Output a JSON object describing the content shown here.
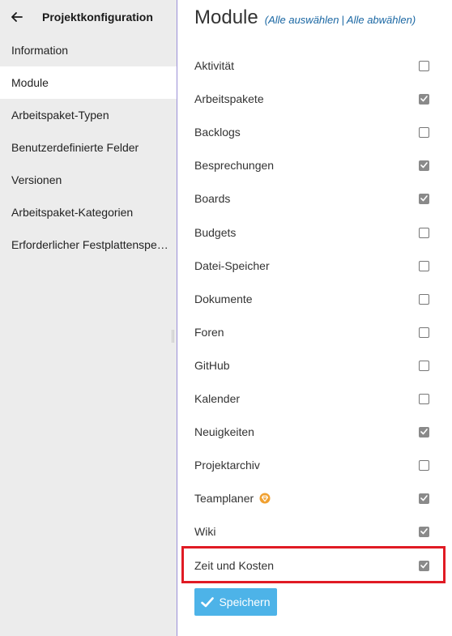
{
  "sidebar": {
    "title": "Projektkonfiguration",
    "back_icon": "arrow-left-icon",
    "items": [
      {
        "label": "Information",
        "active": false
      },
      {
        "label": "Module",
        "active": true
      },
      {
        "label": "Arbeitspaket-Typen",
        "active": false
      },
      {
        "label": "Benutzerdefinierte Felder",
        "active": false
      },
      {
        "label": "Versionen",
        "active": false
      },
      {
        "label": "Arbeitspaket-Kategorien",
        "active": false
      },
      {
        "label": "Erforderlicher Festplattenspeicher",
        "active": false
      }
    ]
  },
  "main": {
    "title": "Module",
    "select_all": "Alle auswählen",
    "separator": "|",
    "deselect_all": "Alle abwählen",
    "modules": [
      {
        "label": "Aktivität",
        "checked": false
      },
      {
        "label": "Arbeitspakete",
        "checked": true
      },
      {
        "label": "Backlogs",
        "checked": false
      },
      {
        "label": "Besprechungen",
        "checked": true
      },
      {
        "label": "Boards",
        "checked": true
      },
      {
        "label": "Budgets",
        "checked": false
      },
      {
        "label": "Datei-Speicher",
        "checked": false
      },
      {
        "label": "Dokumente",
        "checked": false
      },
      {
        "label": "Foren",
        "checked": false
      },
      {
        "label": "GitHub",
        "checked": false
      },
      {
        "label": "Kalender",
        "checked": false
      },
      {
        "label": "Neuigkeiten",
        "checked": true
      },
      {
        "label": "Projektarchiv",
        "checked": false
      },
      {
        "label": "Teamplaner",
        "checked": true,
        "badge_icon": "enterprise-badge-icon"
      },
      {
        "label": "Wiki",
        "checked": true
      },
      {
        "label": "Zeit und Kosten",
        "checked": true,
        "highlighted": true
      }
    ],
    "save_label": "Speichern",
    "colors": {
      "accent_link": "#1a67a3",
      "save_button": "#4db3e8",
      "highlight": "#e01b24",
      "sidebar_bg": "#ececec",
      "enterprise_badge": "#f0a030"
    }
  }
}
